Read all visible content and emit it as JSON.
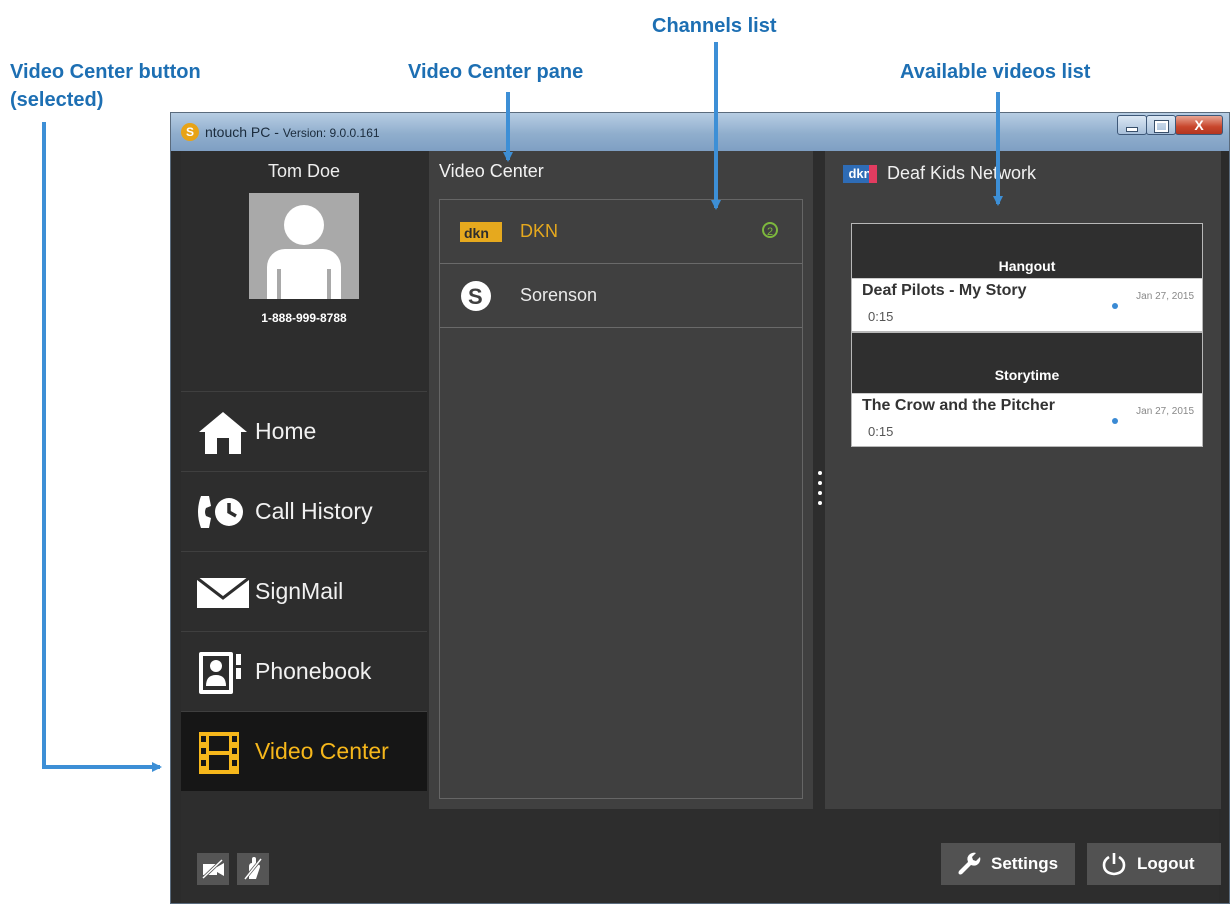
{
  "callouts": {
    "video_center_button": "Video Center button",
    "video_center_button_2": "(selected)",
    "video_center_pane": "Video Center pane",
    "channels_list": "Channels list",
    "available_videos_list": "Available videos list"
  },
  "window": {
    "app_name": "ntouch PC",
    "separator": " - ",
    "version": "Version: 9.0.0.161",
    "buttons": {
      "minimize": "",
      "maximize": "",
      "close": "X"
    }
  },
  "profile": {
    "name": "Tom Doe",
    "phone": "1-888-999-8788"
  },
  "nav": [
    {
      "label": "Home",
      "icon": "home-icon"
    },
    {
      "label": "Call History",
      "icon": "call-history-icon"
    },
    {
      "label": "SignMail",
      "icon": "envelope-icon"
    },
    {
      "label": "Phonebook",
      "icon": "phonebook-icon"
    },
    {
      "label": "Video Center",
      "icon": "film-icon",
      "selected": true
    }
  ],
  "video_center": {
    "title": "Video Center",
    "channels": [
      {
        "logo": "dkn",
        "label": "DKN",
        "badge": "2",
        "active": true
      },
      {
        "logo": "S",
        "label": "Sorenson"
      }
    ]
  },
  "videos_pane": {
    "logo": "dkn",
    "title": "Deaf Kids Network",
    "groups": [
      {
        "name": "Hangout",
        "items": [
          {
            "title": "Deaf Pilots - My Story",
            "duration": "0:15",
            "date": "Jan 27, 2015"
          }
        ]
      },
      {
        "name": "Storytime",
        "items": [
          {
            "title": "The Crow and the Pitcher",
            "duration": "0:15",
            "date": "Jan 27, 2015"
          }
        ]
      }
    ]
  },
  "bottom": {
    "settings": "Settings",
    "logout": "Logout"
  },
  "colors": {
    "accent": "#f6b71b",
    "callout": "#1d6fb3",
    "badge": "#7db83d",
    "dkn_blue": "#2e6cb6"
  }
}
